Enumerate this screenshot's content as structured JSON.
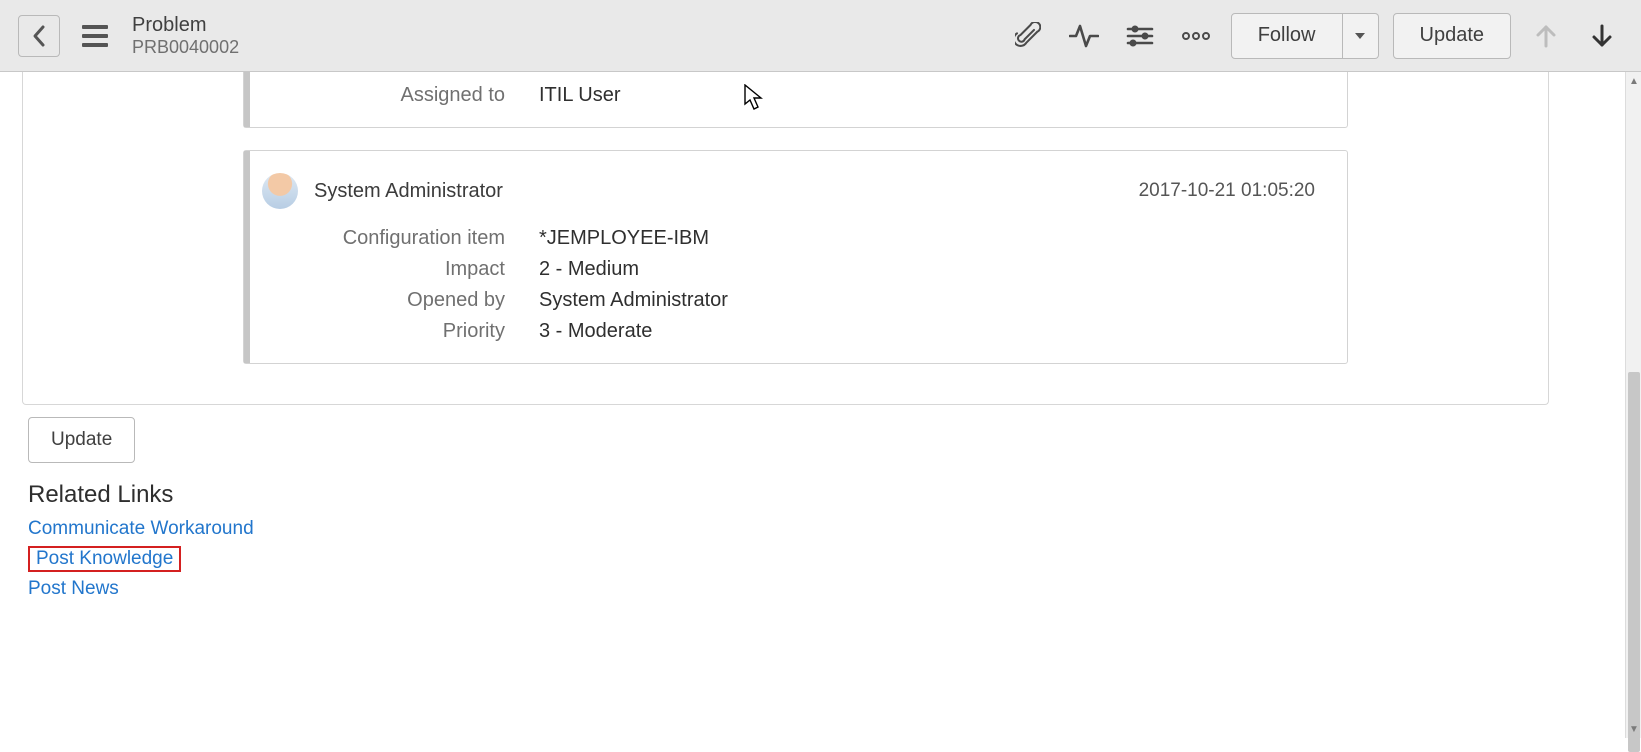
{
  "header": {
    "title": "Problem",
    "record_number": "PRB0040002",
    "follow_label": "Follow",
    "update_label": "Update"
  },
  "activity_partial": {
    "fields": [
      {
        "label": "Assigned to",
        "value": "ITIL User"
      }
    ]
  },
  "activity": {
    "author": "System Administrator",
    "timestamp": "2017-10-21 01:05:20",
    "fields": [
      {
        "label": "Configuration item",
        "value": "*JEMPLOYEE-IBM"
      },
      {
        "label": "Impact",
        "value": "2 - Medium"
      },
      {
        "label": "Opened by",
        "value": "System Administrator"
      },
      {
        "label": "Priority",
        "value": "3 - Moderate"
      }
    ]
  },
  "buttons": {
    "update_below": "Update"
  },
  "related_links": {
    "heading": "Related Links",
    "items": [
      {
        "label": "Communicate Workaround",
        "highlighted": false
      },
      {
        "label": "Post Knowledge",
        "highlighted": true
      },
      {
        "label": "Post News",
        "highlighted": false
      }
    ]
  }
}
